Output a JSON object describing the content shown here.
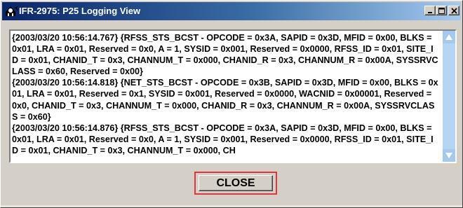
{
  "window": {
    "title": "IFR-2975: P25 Logging View",
    "controls": {
      "minimize": "_",
      "maximize": "□",
      "close": "X"
    },
    "icon": "app-sun-icon"
  },
  "log": {
    "entries": [
      "{2003/03/20 10:56:14.767} {RFSS_STS_BCST - OPCODE = 0x3A, SAPID = 0x3D, MFID = 0x00, BLKS = 0x01, LRA = 0x01, Reserved = 0x0, A = 1, SYSID = 0x001, Reserved = 0x0000, RFSS_ID = 0x01, SITE_ID = 0x01, CHANID_T = 0x3, CHANNUM_T = 0x000, CHANID_R = 0x3, CHANNUM_R = 0x00A, SYSSRVCLASS = 0x60, Reserved = 0x00}",
      "{2003/03/20 10:56:14.818} {NET_STS_BCST - OPCODE = 0x3B, SAPID = 0x3D, MFID = 0x00, BLKS = 0x01, LRA = 0x01, Reserved = 0x1, SYSID = 0x001, Reserved = 0x0000, WACNID = 0x00001, Reserved = 0x0, CHANID_T = 0x3, CHANNUM_T = 0x000, CHANID_R = 0x3, CHANNUM_R = 0x00A, SYSSRVCLASS = 0x60}",
      "{2003/03/20 10:56:14.876} {RFSS_STS_BCST - OPCODE = 0x3A, SAPID = 0x3D, MFID = 0x00, BLKS = 0x01, LRA = 0x01, Reserved = 0x0, A = 1, SYSID = 0x001, Reserved = 0x0000, RFSS_ID = 0x01, SITE_ID = 0x01, CHANID_T = 0x3, CHANNUM_T = 0x000, CH"
    ]
  },
  "scrollbar": {
    "up_icon": "scroll-up-arrow-icon",
    "down_icon": "scroll-down-arrow-icon"
  },
  "footer": {
    "close_label": "CLOSE"
  },
  "colors": {
    "title_start": "#0a246a",
    "title_end": "#a6caf0",
    "face": "#d4d0c8",
    "scrollbar": "#a4c8f0",
    "highlight": "#e03440"
  }
}
